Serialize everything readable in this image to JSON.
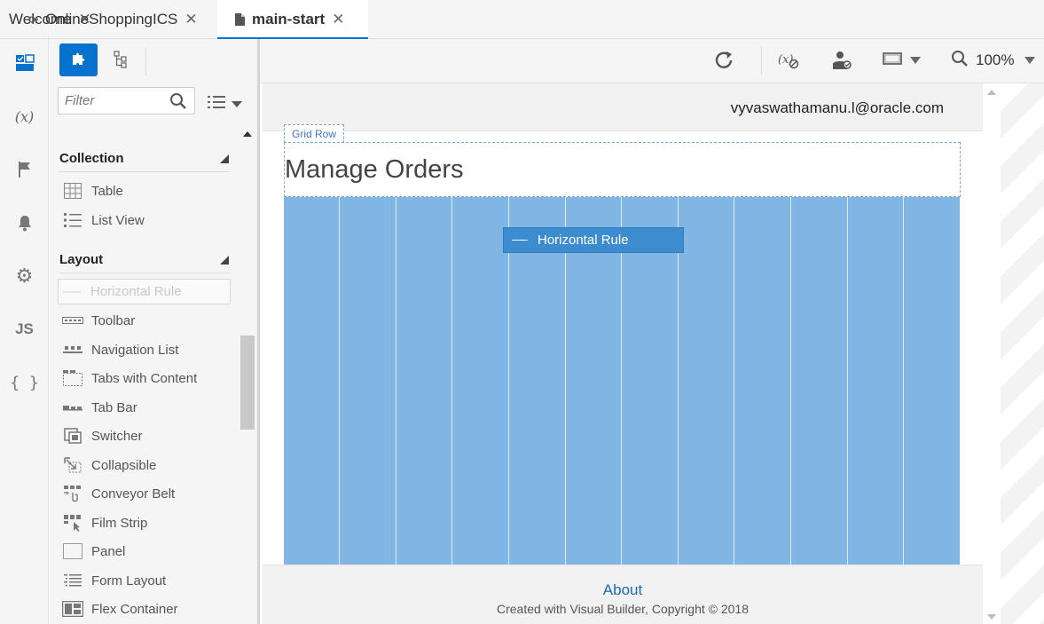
{
  "tabs": [
    {
      "label": "Welcome"
    },
    {
      "label": "OnlineShoppingICS"
    },
    {
      "label": "main-start"
    }
  ],
  "rail": {
    "icons": [
      "page-designer-icon",
      "variables-icon",
      "flag-icon",
      "bell-icon",
      "gear-icon",
      "js-icon",
      "json-braces-icon"
    ],
    "variables_label": "(x)",
    "js_label": "JS",
    "braces_label": "{ }"
  },
  "panel": {
    "filter_placeholder": "Filter",
    "sections": {
      "collection": {
        "title": "Collection",
        "items": [
          {
            "label": "Table",
            "icon": "table-icon"
          },
          {
            "label": "List View",
            "icon": "list-view-icon"
          }
        ]
      },
      "layout": {
        "title": "Layout",
        "items": [
          {
            "label": "Horizontal Rule",
            "icon": "horizontal-rule-icon",
            "state": "dragging"
          },
          {
            "label": "Toolbar",
            "icon": "toolbar-icon"
          },
          {
            "label": "Navigation List",
            "icon": "navigation-list-icon"
          },
          {
            "label": "Tabs with Content",
            "icon": "tabs-icon"
          },
          {
            "label": "Tab Bar",
            "icon": "tab-bar-icon"
          },
          {
            "label": "Switcher",
            "icon": "switcher-icon"
          },
          {
            "label": "Collapsible",
            "icon": "collapsible-icon"
          },
          {
            "label": "Conveyor Belt",
            "icon": "conveyor-belt-icon"
          },
          {
            "label": "Film Strip",
            "icon": "film-strip-icon"
          },
          {
            "label": "Panel",
            "icon": "panel-icon"
          },
          {
            "label": "Form Layout",
            "icon": "form-layout-icon"
          },
          {
            "label": "Flex Container",
            "icon": "flex-container-icon"
          }
        ]
      }
    }
  },
  "toolbar": {
    "zoom": "100%"
  },
  "page": {
    "user_email": "vyvaswathamanu.l@oracle.com",
    "grid_row_label": "Grid Row",
    "title": "Manage Orders",
    "drag_label": "Horizontal Rule",
    "footer_link": "About",
    "footer_text": "Created with Visual Builder, Copyright © 2018"
  },
  "colors": {
    "accent": "#0572ce",
    "grid_overlay": "#80b5e4",
    "drag_tip": "#3d8ccf"
  }
}
